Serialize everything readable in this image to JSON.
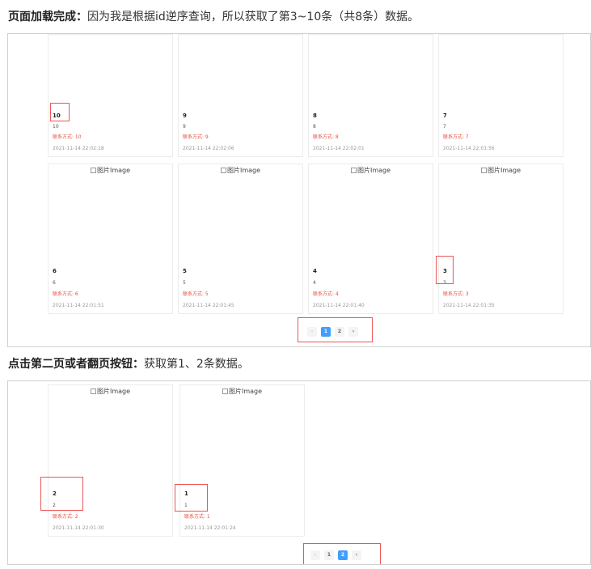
{
  "sections": [
    {
      "heading_bold": "页面加载完成：",
      "heading_text": "因为我是根据id逆序查询，所以获取了第3~10条（共8条）数据。",
      "cards": [
        {
          "title": "10",
          "subtitle": "10",
          "contact": "联系方式: 10",
          "time": "2021-11-14 22:02:18",
          "image_label": ""
        },
        {
          "title": "9",
          "subtitle": "9",
          "contact": "联系方式: 9",
          "time": "2021-11-14 22:02:06",
          "image_label": ""
        },
        {
          "title": "8",
          "subtitle": "8",
          "contact": "联系方式: 8",
          "time": "2021-11-14 22:02:01",
          "image_label": ""
        },
        {
          "title": "7",
          "subtitle": "7",
          "contact": "联系方式: 7",
          "time": "2021-11-14 22:01:56",
          "image_label": ""
        },
        {
          "title": "6",
          "subtitle": "6",
          "contact": "联系方式: 6",
          "time": "2021-11-14 22:01:51",
          "image_label": "图片Image"
        },
        {
          "title": "5",
          "subtitle": "5",
          "contact": "联系方式: 5",
          "time": "2021-11-14 22:01:45",
          "image_label": "图片Image"
        },
        {
          "title": "4",
          "subtitle": "4",
          "contact": "联系方式: 4",
          "time": "2021-11-14 22:01:40",
          "image_label": "图片Image"
        },
        {
          "title": "3",
          "subtitle": "3",
          "contact": "联系方式: 3",
          "time": "2021-11-14 22:01:35",
          "image_label": "图片Image"
        }
      ],
      "pagination": {
        "prev": "‹",
        "pages": [
          "1",
          "2"
        ],
        "active_page": "1",
        "next": "›"
      }
    },
    {
      "heading_bold": "点击第二页或者翻页按钮：",
      "heading_text": "获取第1、2条数据。",
      "cards": [
        {
          "title": "2",
          "subtitle": "2",
          "contact": "联系方式: 2",
          "time": "2021-11-14 22:01:30",
          "image_label": "图片Image"
        },
        {
          "title": "1",
          "subtitle": "1",
          "contact": "联系方式: 1",
          "time": "2021-11-14 22:01:24",
          "image_label": "图片Image"
        }
      ],
      "pagination": {
        "prev": "‹",
        "pages": [
          "1",
          "2"
        ],
        "active_page": "2",
        "next": "›"
      }
    }
  ],
  "highlight_color": "#ee5555",
  "active_page_color": "#409eff",
  "contact_color": "#e74c3c"
}
